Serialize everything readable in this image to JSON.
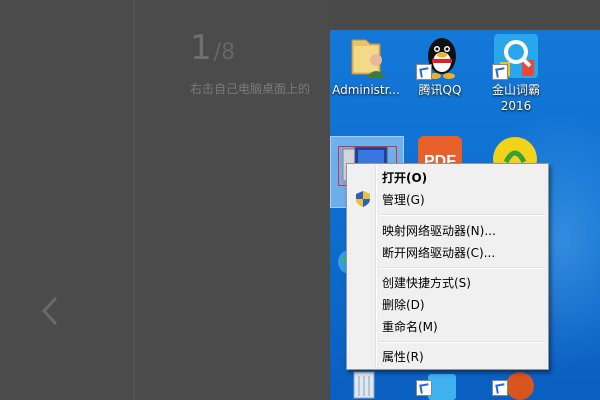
{
  "tutorial": {
    "step_current": "1",
    "step_separator": "/",
    "step_total": "8",
    "caption": "右击自己电脑桌面上的"
  },
  "desktop": {
    "icons": [
      {
        "label": "Administr...",
        "icon": "user-folder-icon"
      },
      {
        "label": "腾讯QQ",
        "icon": "qq-penguin-icon"
      },
      {
        "label": "金山词霸",
        "label2": "2016",
        "icon": "kingsoft-dict-icon"
      }
    ]
  },
  "context_menu": {
    "open": "打开(O)",
    "manage": "管理(G)",
    "map_drive": "映射网络驱动器(N)...",
    "disconnect_drive": "断开网络驱动器(C)...",
    "create_shortcut": "创建快捷方式(S)",
    "delete": "删除(D)",
    "rename": "重命名(M)",
    "properties": "属性(R)"
  },
  "colors": {
    "desktop_blue": "#1478d8",
    "menu_bg": "#f0f0f0",
    "highlight_box": "#e03030",
    "overlay": "#4b4b4b"
  }
}
